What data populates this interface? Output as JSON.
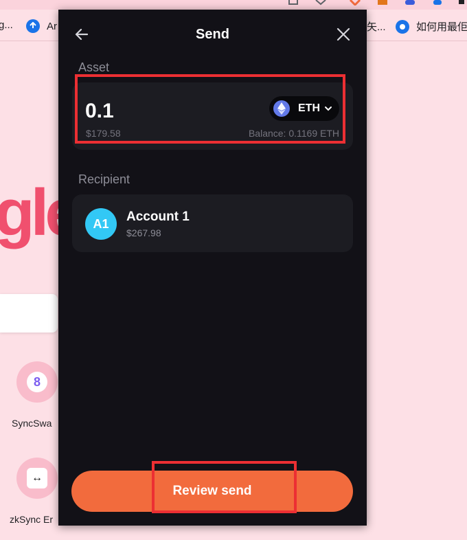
{
  "colors": {
    "page_bg": "#fde0e6",
    "popup_bg": "#121117",
    "card_bg": "#1c1c22",
    "accent": "#f26b3d",
    "avatar": "#32c8f5",
    "eth": "#6279e8",
    "highlight": "#ec2f33"
  },
  "browser": {
    "bookmarks": [
      {
        "label": "g...",
        "icon": "bookmark-icon"
      },
      {
        "label": "Ar",
        "icon": "upload-icon"
      },
      {
        "label": "矢...",
        "icon": ""
      },
      {
        "label": "如何用最佢",
        "icon": "lock-icon"
      }
    ]
  },
  "background_page": {
    "logo_text": "gle",
    "shortcuts": [
      {
        "label": "SyncSwa",
        "icon": "syncswap-icon",
        "glyph": "8"
      },
      {
        "label": "zkSync Er",
        "icon": "zksync-icon",
        "glyph": "↔"
      }
    ]
  },
  "popup": {
    "title": "Send",
    "back_icon": "arrow-left-icon",
    "close_icon": "close-icon",
    "asset": {
      "label": "Asset",
      "amount": "0.1",
      "fiat_value": "$179.58",
      "token_symbol": "ETH",
      "token_icon": "ethereum-icon",
      "balance": "Balance: 0.1169 ETH"
    },
    "recipient": {
      "label": "Recipient",
      "avatar_initials": "A1",
      "account_name": "Account 1",
      "account_balance": "$267.98"
    },
    "review_button": "Review send"
  }
}
